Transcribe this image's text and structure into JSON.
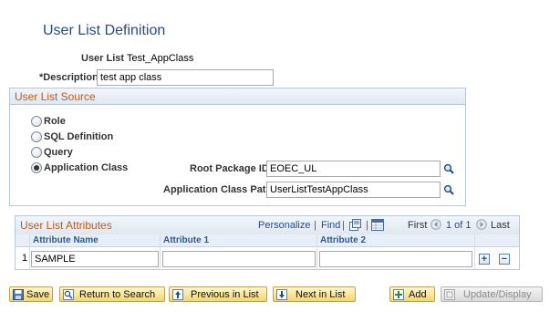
{
  "page": {
    "title": "User List Definition"
  },
  "fields": {
    "user_list_label": "User List",
    "user_list_value": "Test_AppClass",
    "description_label": "*Description",
    "description_value": "test app class"
  },
  "source": {
    "title": "User List Source",
    "options": [
      "Role",
      "SQL Definition",
      "Query",
      "Application Class"
    ],
    "selected": "Application Class",
    "root_package_label": "Root Package ID",
    "root_package_value": "EOEC_UL",
    "app_class_path_label": "Application Class Path",
    "app_class_path_value": "UserListTestAppClass"
  },
  "attributes": {
    "title": "User List Attributes",
    "personalize": "Personalize",
    "find": "Find",
    "separator": "|",
    "first": "First",
    "range": "1 of 1",
    "last": "Last",
    "columns": [
      "Attribute Name",
      "Attribute 1",
      "Attribute 2"
    ],
    "rows": [
      {
        "num": "1",
        "name": "SAMPLE",
        "attr1": "",
        "attr2": ""
      }
    ],
    "add_symbol": "+",
    "remove_symbol": "−"
  },
  "toolbar": {
    "save": "Save",
    "return_to_search": "Return to Search",
    "previous_in_list": "Previous in List",
    "next_in_list": "Next in List",
    "add": "Add",
    "update_display": "Update/Display"
  }
}
